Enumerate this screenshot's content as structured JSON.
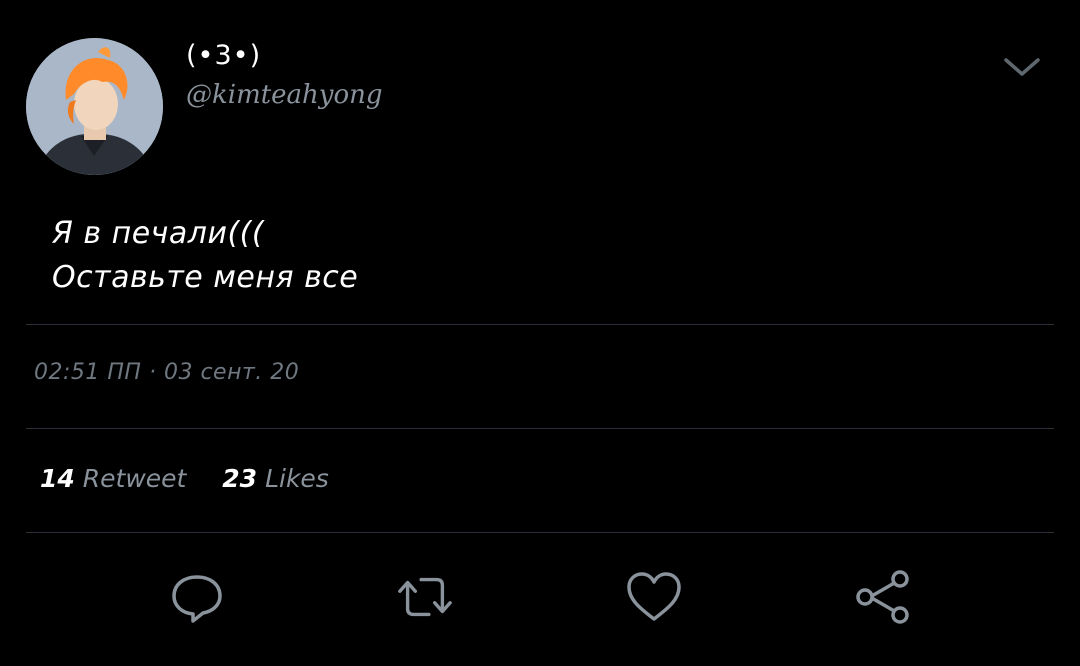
{
  "tweet": {
    "author": {
      "display_name": "(•3•)",
      "handle": "@kimteahyong"
    },
    "text_lines": [
      "Я в печали(((",
      "Оставьте меня все"
    ],
    "timestamp": "02:51 ПП · 03 сент. 20",
    "stats": {
      "retweets_count": "14",
      "retweets_label": "Retweet",
      "likes_count": "23",
      "likes_label": "Likes"
    }
  },
  "icons": {
    "menu": "chevron-down-icon",
    "reply": "reply-icon",
    "retweet": "retweet-icon",
    "like": "heart-icon",
    "share": "share-icon"
  },
  "colors": {
    "background": "#000000",
    "primary_text": "#ffffff",
    "secondary_text": "#8a939c",
    "icon": "#8a939c",
    "divider": "#2a2f35"
  }
}
